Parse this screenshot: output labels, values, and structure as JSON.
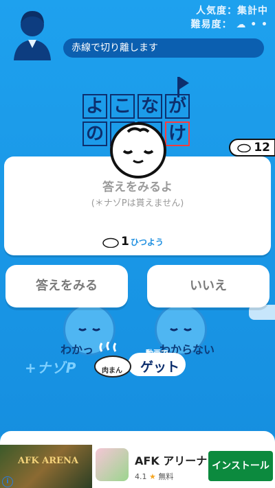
{
  "header": {
    "popularity_label": "人気度：集計中",
    "difficulty_label": "難易度：",
    "instruction": "赤線で切り離します"
  },
  "puzzle": {
    "row1": [
      "よ",
      "こ",
      "な",
      "が"
    ],
    "row2": [
      "の",
      "",
      "",
      "け"
    ]
  },
  "coins": {
    "count": "12"
  },
  "dialog": {
    "title": "答えをみるよ",
    "note": "(＊ナゾPは貰えません)",
    "cost_number": "1",
    "cost_unit": "ひつよう"
  },
  "buttons": {
    "show_answer": "答えをみる",
    "no": "いいえ"
  },
  "background_faces": {
    "know": "わかっ",
    "dont_know": "わからない"
  },
  "plus_nazo": "+ナゾP",
  "bun_get": {
    "bun_label": "肉まん",
    "small": "動画で",
    "get": "ゲット"
  },
  "ad": {
    "game_title": "AFK ARENA",
    "app_name": "AFK アリーナ",
    "rating": "4.1",
    "price": "無料",
    "install": "インストール",
    "info": "i"
  },
  "colors": {
    "bg": "#1ea1ee",
    "ink": "#0d2f6e",
    "install": "#0c8a3e"
  }
}
